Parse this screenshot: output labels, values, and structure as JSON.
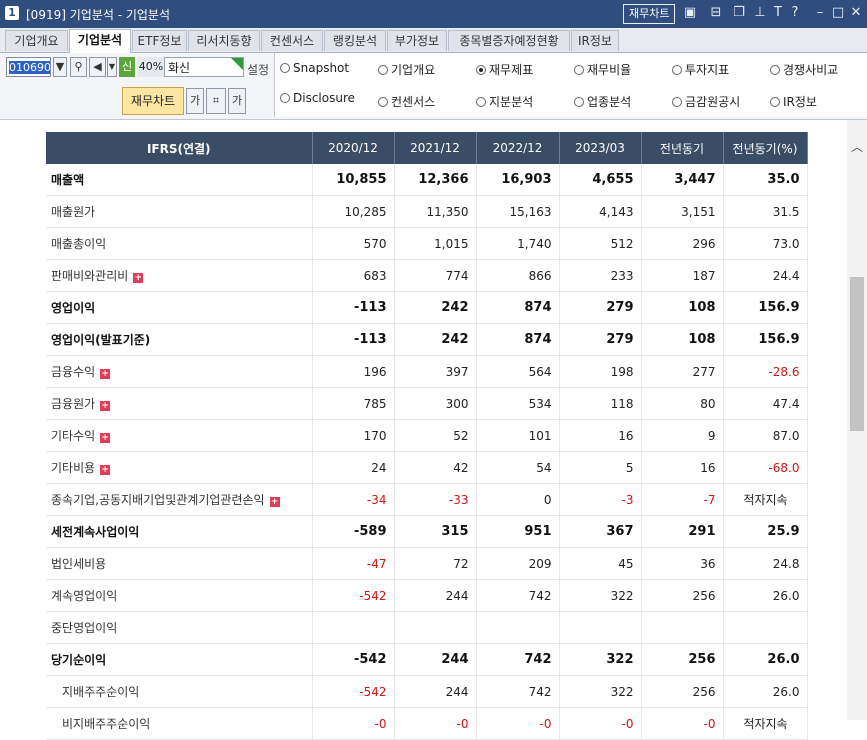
{
  "window": {
    "number": "1",
    "title": "[0919] 기업분석 - 기업분석",
    "chart_button": "재무차트",
    "icons": [
      "graph-icon",
      "layout-icon",
      "copy-icon",
      "pin-icon",
      "font-icon",
      "help-icon",
      "minimize-icon",
      "maximize-icon",
      "close-icon"
    ],
    "accent": "#2f4e7e"
  },
  "tabs": [
    "기업개요",
    "기업분석",
    "ETF정보",
    "리서치동향",
    "컨센서스",
    "랭킹분석",
    "부가정보",
    "종목별증자예정현황",
    "IR정보"
  ],
  "active_tab": "기업분석",
  "controls": {
    "code": "010690",
    "new_badge": "신",
    "percent": "40%",
    "company": "화신",
    "settings_label": "설정",
    "finance_chart_button": "재무차트",
    "small_buttons": [
      "가",
      "가"
    ]
  },
  "radio_options": [
    {
      "label": "Snapshot",
      "selected": false
    },
    {
      "label": "기업개요",
      "selected": false
    },
    {
      "label": "재무제표",
      "selected": true
    },
    {
      "label": "재무비율",
      "selected": false
    },
    {
      "label": "투자지표",
      "selected": false
    },
    {
      "label": "경쟁사비교",
      "selected": false
    },
    {
      "label": "Disclosure",
      "selected": false
    },
    {
      "label": "컨센서스",
      "selected": false
    },
    {
      "label": "지분분석",
      "selected": false
    },
    {
      "label": "업종분석",
      "selected": false
    },
    {
      "label": "금감원공시",
      "selected": false
    },
    {
      "label": "IR정보",
      "selected": false
    }
  ],
  "table": {
    "headers": [
      "IFRS(연결)",
      "2020/12",
      "2021/12",
      "2022/12",
      "2023/03",
      "전년동기",
      "전년동기(%)"
    ],
    "rows": [
      {
        "label": "매출액",
        "values": [
          "10,855",
          "12,366",
          "16,903",
          "4,655",
          "3,447",
          "35.0"
        ],
        "bold": true
      },
      {
        "label": "매출원가",
        "values": [
          "10,285",
          "11,350",
          "15,163",
          "4,143",
          "3,151",
          "31.5"
        ]
      },
      {
        "label": "매출총이익",
        "values": [
          "570",
          "1,015",
          "1,740",
          "512",
          "296",
          "73.0"
        ]
      },
      {
        "label": "판매비와관리비",
        "values": [
          "683",
          "774",
          "866",
          "233",
          "187",
          "24.4"
        ],
        "plus": true
      },
      {
        "label": "영업이익",
        "values": [
          "-113",
          "242",
          "874",
          "279",
          "108",
          "156.9"
        ],
        "bold": true,
        "sep": true
      },
      {
        "label": "영업이익(발표기준)",
        "values": [
          "-113",
          "242",
          "874",
          "279",
          "108",
          "156.9"
        ],
        "bold": true
      },
      {
        "label": "금융수익",
        "values": [
          "196",
          "397",
          "564",
          "198",
          "277",
          "-28.6"
        ],
        "plus": true
      },
      {
        "label": "금융원가",
        "values": [
          "785",
          "300",
          "534",
          "118",
          "80",
          "47.4"
        ],
        "plus": true
      },
      {
        "label": "기타수익",
        "values": [
          "170",
          "52",
          "101",
          "16",
          "9",
          "87.0"
        ],
        "plus": true
      },
      {
        "label": "기타비용",
        "values": [
          "24",
          "42",
          "54",
          "5",
          "16",
          "-68.0"
        ],
        "plus": true
      },
      {
        "label": "종속기업,공동지배기업및관계기업관련손익",
        "values": [
          "-34",
          "-33",
          "0",
          "-3",
          "-7",
          "적자지속"
        ],
        "plus": true
      },
      {
        "label": "세전계속사업이익",
        "values": [
          "-589",
          "315",
          "951",
          "367",
          "291",
          "25.9"
        ],
        "bold": true
      },
      {
        "label": "법인세비용",
        "values": [
          "-47",
          "72",
          "209",
          "45",
          "36",
          "24.8"
        ]
      },
      {
        "label": "계속영업이익",
        "values": [
          "-542",
          "244",
          "742",
          "322",
          "256",
          "26.0"
        ]
      },
      {
        "label": "중단영업이익",
        "values": [
          "",
          "",
          "",
          "",
          "",
          ""
        ]
      },
      {
        "label": "당기순이익",
        "values": [
          "-542",
          "244",
          "742",
          "322",
          "256",
          "26.0"
        ],
        "bold": true,
        "sep": true
      },
      {
        "label": "지배주주순이익",
        "values": [
          "-542",
          "244",
          "742",
          "322",
          "256",
          "26.0"
        ],
        "sub": true
      },
      {
        "label": "비지배주주순이익",
        "values": [
          "-0",
          "-0",
          "-0",
          "-0",
          "-0",
          "적자지속"
        ],
        "sub": true
      }
    ]
  }
}
